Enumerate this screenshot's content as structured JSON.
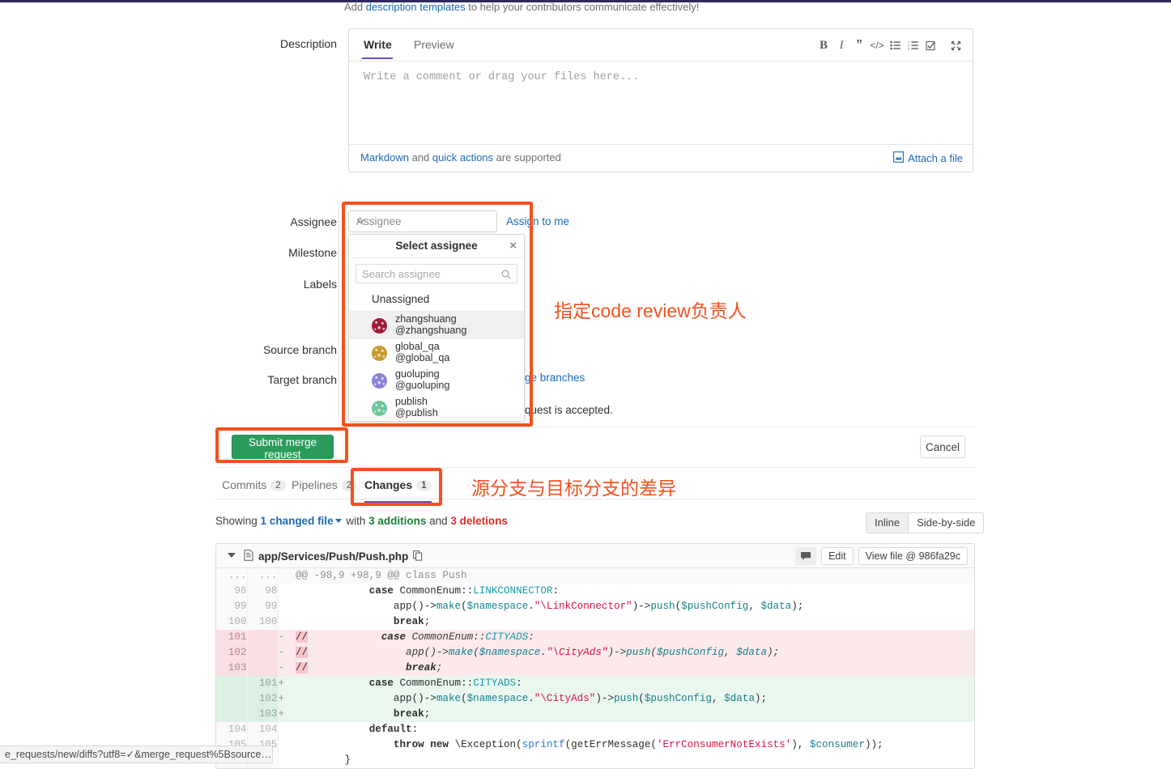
{
  "top_hint": {
    "before": "Add ",
    "link": "description templates",
    "after": " to help your contributors communicate effectively!"
  },
  "description": {
    "label": "Description",
    "tabs": {
      "write": "Write",
      "preview": "Preview"
    },
    "placeholder": "Write a comment or drag your files here...",
    "toolbar": [
      {
        "name": "bold-icon",
        "label": "B"
      },
      {
        "name": "italic-icon",
        "label": "I"
      },
      {
        "name": "quote-icon",
        "label": "”"
      },
      {
        "name": "code-icon",
        "label": "<>"
      },
      {
        "name": "bullet-list-icon",
        "label": "≡"
      },
      {
        "name": "numbered-list-icon",
        "label": "☰"
      },
      {
        "name": "task-list-icon",
        "label": "☑"
      },
      {
        "name": "fullscreen-icon",
        "label": "⤡"
      }
    ],
    "footer": {
      "markdown": "Markdown",
      "and": " and ",
      "quick_actions": "quick actions",
      "supported": " are supported",
      "attach": "Attach a file"
    }
  },
  "form": {
    "assignee_label": "Assignee",
    "milestone_label": "Milestone",
    "labels_label": "Labels",
    "source_branch_label": "Source branch",
    "target_branch_label": "Target branch",
    "assignee_value": "Assignee",
    "assign_to_me": "Assign to me",
    "behind_change_branches": "ge branches",
    "behind_request_accepted": "quest is accepted."
  },
  "assignee_dropdown": {
    "title": "Select assignee",
    "close": "×",
    "search_placeholder": "Search assignee",
    "unassigned": "Unassigned",
    "items": [
      {
        "name": "zhangshuang",
        "handle": "@zhangshuang",
        "color": "#9e1b35",
        "active": true
      },
      {
        "name": "global_qa",
        "handle": "@global_qa",
        "color": "#c99a2e",
        "active": false
      },
      {
        "name": "guoluping",
        "handle": "@guoluping",
        "color": "#8b82d9",
        "active": false
      },
      {
        "name": "publish",
        "handle": "@publish",
        "color": "#6cc69a",
        "active": false
      }
    ]
  },
  "actions": {
    "submit_label": "Submit merge request",
    "cancel_label": "Cancel"
  },
  "annotations": {
    "accent_color": "#f4511e",
    "assignee_note": "指定code review负责人",
    "changes_note": "源分支与目标分支的差异"
  },
  "mr_tabs": [
    {
      "name": "tab-commits",
      "label": "Commits",
      "badge": "2",
      "current": false
    },
    {
      "name": "tab-pipelines",
      "label": "Pipelines",
      "badge": "2",
      "current": false
    },
    {
      "name": "tab-changes",
      "label": "Changes",
      "badge": "1",
      "current": true
    }
  ],
  "changes_summary": {
    "showing": "Showing ",
    "changed_file": "1 changed file",
    "with": " with ",
    "additions": "3 additions",
    "and": " and ",
    "deletions": "3 deletions",
    "view_inline": "Inline",
    "view_side_by_side": "Side-by-side"
  },
  "diff_file": {
    "path": "app/Services/Push/Push.php",
    "copy_icon": "copy-path-icon",
    "comment_icon": "comment-icon",
    "edit_label": "Edit",
    "view_file_label": "View file @ 986fa29c",
    "rows": [
      {
        "type": "meta",
        "old": "...",
        "new": "...",
        "sign": "",
        "code": "@@ -98,9 +98,9 @@ class Push"
      },
      {
        "type": "context",
        "old": "98",
        "new": "98",
        "sign": "",
        "code": "            case CommonEnum::LINKCONNECTOR:"
      },
      {
        "type": "context",
        "old": "99",
        "new": "99",
        "sign": "",
        "code": "                app()->make($namespace.\"\\LinkConnector\")->push($pushConfig, $data);"
      },
      {
        "type": "context",
        "old": "100",
        "new": "100",
        "sign": "",
        "code": "                break;"
      },
      {
        "type": "del",
        "old": "101",
        "new": "",
        "sign": "-",
        "code": "//            case CommonEnum::CITYADS:"
      },
      {
        "type": "del",
        "old": "102",
        "new": "",
        "sign": "-",
        "code": "//                app()->make($namespace.\"\\CityAds\")->push($pushConfig, $data);"
      },
      {
        "type": "del",
        "old": "103",
        "new": "",
        "sign": "-",
        "code": "//                break;"
      },
      {
        "type": "add",
        "old": "",
        "new": "101",
        "sign": "+",
        "code": "            case CommonEnum::CITYADS:"
      },
      {
        "type": "add",
        "old": "",
        "new": "102",
        "sign": "+",
        "code": "                app()->make($namespace.\"\\CityAds\")->push($pushConfig, $data);"
      },
      {
        "type": "add",
        "old": "",
        "new": "103",
        "sign": "+",
        "code": "                break;"
      },
      {
        "type": "context",
        "old": "104",
        "new": "104",
        "sign": "",
        "code": "            default:"
      },
      {
        "type": "context",
        "old": "105",
        "new": "105",
        "sign": "",
        "code": "                throw new \\Exception(sprintf(getErrMessage('ErrConsumerNotExists'), $consumer));"
      },
      {
        "type": "context",
        "old": "",
        "new": "",
        "sign": "",
        "code": "        }"
      }
    ]
  },
  "status_bar": {
    "url": "e_requests/new/diffs?utf8=✓&merge_request%5Bsource…"
  }
}
